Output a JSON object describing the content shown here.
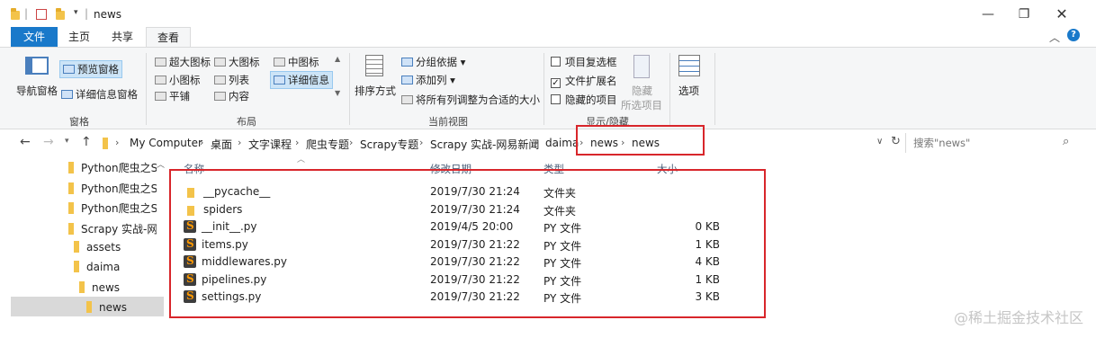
{
  "window": {
    "title": "news",
    "minimize_icon": "minimize-icon",
    "maximize_icon": "restore-icon",
    "close_icon": "close-icon"
  },
  "quick_access": {
    "divider": "|"
  },
  "tabs": [
    {
      "label": "文件"
    },
    {
      "label": "主页"
    },
    {
      "label": "共享"
    },
    {
      "label": "查看"
    }
  ],
  "ribbon": {
    "panes": {
      "nav_pane": "导航窗格",
      "preview": "预览窗格",
      "details": "详细信息窗格",
      "label": "窗格"
    },
    "layout": {
      "items": [
        "超大图标",
        "大图标",
        "中图标",
        "小图标",
        "列表",
        "详细信息",
        "平铺",
        "内容"
      ],
      "label": "布局"
    },
    "current_view": {
      "sort": "排序方式",
      "group_by": "分组依据",
      "add_columns": "添加列",
      "fit_columns": "将所有列调整为合适的大小",
      "label": "当前视图"
    },
    "show_hide": {
      "item_checkboxes": "项目复选框",
      "file_extensions": "文件扩展名",
      "hidden_items": "隐藏的项目",
      "hide_selected_1": "隐藏",
      "hide_selected_2": "所选项目",
      "label": "显示/隐藏"
    },
    "options": "选项"
  },
  "address": {
    "crumbs": [
      "My Computer",
      "桌面",
      "文字课程",
      "爬虫专题",
      "Scrapy专题",
      "Scrapy 实战-网易新闻",
      "daima",
      "news",
      "news"
    ],
    "search_placeholder": "搜索\"news\""
  },
  "nav_pane": [
    {
      "label": "Python爬虫之Sc"
    },
    {
      "label": "Python爬虫之Sc"
    },
    {
      "label": "Python爬虫之Sc"
    },
    {
      "label": "Scrapy 实战-网易"
    },
    {
      "label": "assets"
    },
    {
      "label": "daima"
    },
    {
      "label": "news"
    },
    {
      "label": "news"
    }
  ],
  "columns": {
    "name": "名称",
    "date": "修改日期",
    "type": "类型",
    "size": "大小"
  },
  "files": [
    {
      "name": "__pycache__",
      "date": "2019/7/30 21:24",
      "type": "文件夹",
      "size": "",
      "kind": "folder"
    },
    {
      "name": "spiders",
      "date": "2019/7/30 21:24",
      "type": "文件夹",
      "size": "",
      "kind": "folder"
    },
    {
      "name": "__init__.py",
      "date": "2019/4/5 20:00",
      "type": "PY 文件",
      "size": "0 KB",
      "kind": "py"
    },
    {
      "name": "items.py",
      "date": "2019/7/30 21:22",
      "type": "PY 文件",
      "size": "1 KB",
      "kind": "py"
    },
    {
      "name": "middlewares.py",
      "date": "2019/7/30 21:22",
      "type": "PY 文件",
      "size": "4 KB",
      "kind": "py"
    },
    {
      "name": "pipelines.py",
      "date": "2019/7/30 21:22",
      "type": "PY 文件",
      "size": "1 KB",
      "kind": "py"
    },
    {
      "name": "settings.py",
      "date": "2019/7/30 21:22",
      "type": "PY 文件",
      "size": "3 KB",
      "kind": "py"
    }
  ],
  "watermark": "@稀土掘金技术社区",
  "colors": {
    "accent": "#1979ca",
    "highlight": "#d8262b",
    "folder": "#f3c34a"
  }
}
